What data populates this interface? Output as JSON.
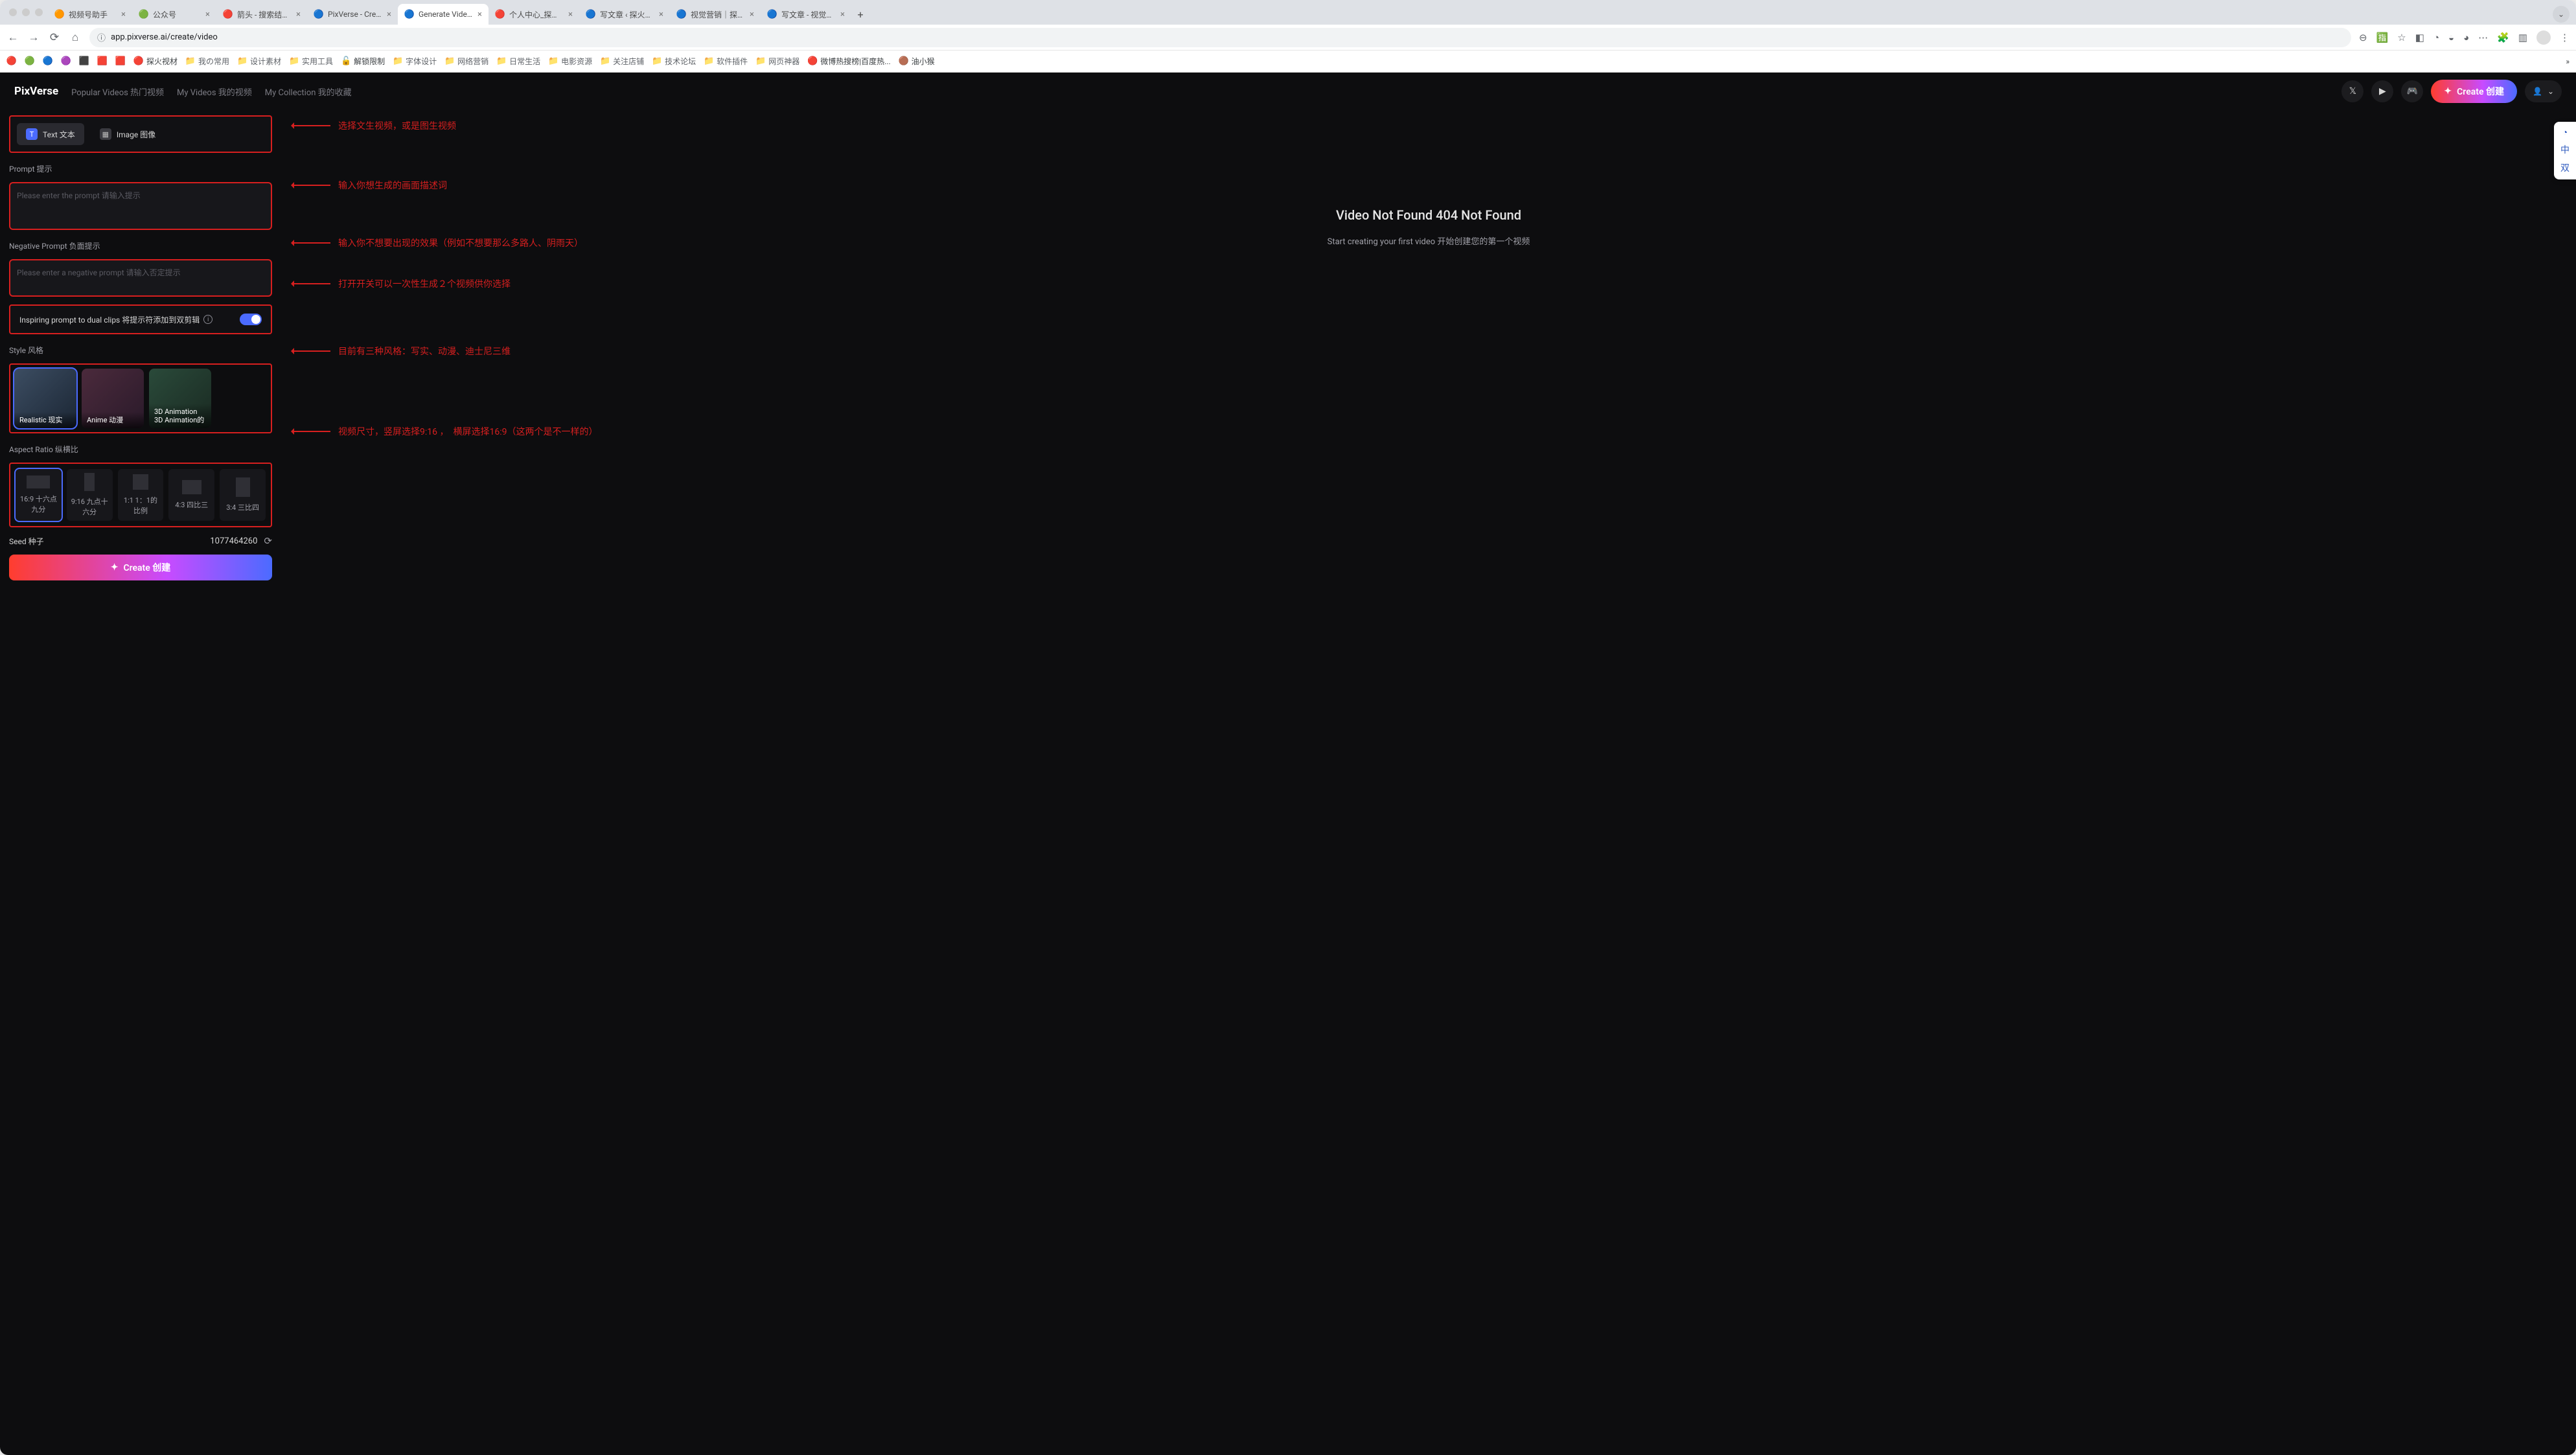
{
  "browser": {
    "tabs": [
      {
        "icon": "🟠",
        "label": "视频号助手"
      },
      {
        "icon": "🟢",
        "label": "公众号"
      },
      {
        "icon": "🔴",
        "label": "箭头 - 搜索结果 - 花瓣"
      },
      {
        "icon": "🔵",
        "label": "PixVerse - Create br..."
      },
      {
        "icon": "🔵",
        "label": "Generate Videos",
        "active": true
      },
      {
        "icon": "🔴",
        "label": "个人中心_探火视材-月..."
      },
      {
        "icon": "🔵",
        "label": "写文章 ‹ 探火视材-月..."
      },
      {
        "icon": "🔵",
        "label": "视觉营销｜探火TanH..."
      },
      {
        "icon": "🔵",
        "label": "写文章 - 视觉营销｜探..."
      }
    ],
    "new_tab": "+",
    "url": "app.pixverse.ai/create/video",
    "bookmarks": [
      {
        "ic": "🔴",
        "label": ""
      },
      {
        "ic": "🟢",
        "label": ""
      },
      {
        "ic": "🔵",
        "label": ""
      },
      {
        "ic": "🟣",
        "label": ""
      },
      {
        "ic": "⬛",
        "label": ""
      },
      {
        "ic": "🟥",
        "label": ""
      },
      {
        "ic": "🟥",
        "label": ""
      },
      {
        "ic": "🔴",
        "label": "探火视材"
      },
      {
        "ic": "📁",
        "label": "我の常用"
      },
      {
        "ic": "📁",
        "label": "设计素材"
      },
      {
        "ic": "📁",
        "label": "实用工具"
      },
      {
        "ic": "🔓",
        "label": "解锁限制"
      },
      {
        "ic": "📁",
        "label": "字体设计"
      },
      {
        "ic": "📁",
        "label": "网络营销"
      },
      {
        "ic": "📁",
        "label": "日常生活"
      },
      {
        "ic": "📁",
        "label": "电影资源"
      },
      {
        "ic": "📁",
        "label": "关注店铺"
      },
      {
        "ic": "📁",
        "label": "技术论坛"
      },
      {
        "ic": "📁",
        "label": "软件插件"
      },
      {
        "ic": "📁",
        "label": "网页神器"
      },
      {
        "ic": "🔴",
        "label": "微博热搜榜|百度热..."
      },
      {
        "ic": "🟤",
        "label": "油小猴"
      }
    ],
    "bookmark_more": "»"
  },
  "nav": {
    "brand": "PixVerse",
    "links": {
      "popular": "Popular Videos 热门视频",
      "mine": "My Videos 我的视频",
      "collection": "My Collection 我的收藏"
    },
    "create": "Create 创建"
  },
  "mode": {
    "text": "Text 文本",
    "image": "Image 图像"
  },
  "prompt": {
    "label": "Prompt 提示",
    "placeholder": "Please enter the prompt 请输入提示"
  },
  "neg": {
    "label": "Negative Prompt 负面提示",
    "placeholder": "Please enter a negative prompt 请输入否定提示"
  },
  "dual": {
    "label": "Inspiring prompt to dual clips 将提示符添加到双剪辑"
  },
  "style": {
    "label": "Style 风格",
    "items": [
      {
        "name": "Realistic 现实"
      },
      {
        "name": "Anime 动漫"
      },
      {
        "name": "3D Animation 3D Animation的"
      }
    ]
  },
  "aspect": {
    "label": "Aspect Ratio 纵横比",
    "items": [
      {
        "name": "16:9 十六点九分"
      },
      {
        "name": "9:16 九点十六分"
      },
      {
        "name": "1:1 1：1的比例"
      },
      {
        "name": "4:3 四比三"
      },
      {
        "name": "3:4 三比四"
      }
    ]
  },
  "seed": {
    "label": "Seed 种子",
    "value": "1077464260"
  },
  "action": {
    "create": "Create 创建"
  },
  "empty": {
    "title": "Video Not Found 404 Not Found",
    "sub": "Start creating your first video 开始创建您的第一个视频"
  },
  "annotations": {
    "mode": "选择文生视频，或是图生视频",
    "prompt": "输入你想生成的画面描述词",
    "neg": "输入你不想要出现的效果（例如不想要那么多路人、阴雨天）",
    "dual": "打开开关可以一次性生成２个视频供你选择",
    "style": "目前有三种风格：写实、动漫、迪士尼三维",
    "aspect": "视频尺寸，竖屏选择9:16 ，　横屏选择16:9（这两个是不一样的）"
  },
  "side_widget": {
    "a": "中",
    "b": "双"
  }
}
